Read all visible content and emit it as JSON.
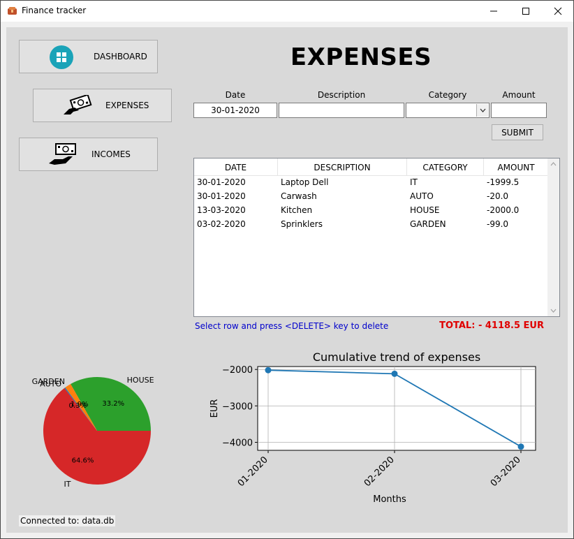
{
  "window": {
    "title": "Finance tracker"
  },
  "nav": {
    "dashboard": "DASHBOARD",
    "expenses": "EXPENSES",
    "incomes": "INCOMES"
  },
  "page": {
    "heading": "EXPENSES"
  },
  "form": {
    "date_label": "Date",
    "description_label": "Description",
    "category_label": "Category",
    "amount_label": "Amount",
    "date_value": "30-01-2020",
    "description_value": "",
    "category_value": "",
    "amount_value": "",
    "submit_label": "SUBMIT"
  },
  "table": {
    "columns": [
      "DATE",
      "DESCRIPTION",
      "CATEGORY",
      "AMOUNT"
    ],
    "rows": [
      [
        "30-01-2020",
        "Laptop Dell",
        "IT",
        "-1999.5"
      ],
      [
        "30-01-2020",
        "Carwash",
        "AUTO",
        "-20.0"
      ],
      [
        "13-03-2020",
        "Kitchen",
        "HOUSE",
        "-2000.0"
      ],
      [
        "03-02-2020",
        "Sprinklers",
        "GARDEN",
        "-99.0"
      ]
    ]
  },
  "hint": "Select row and press <DELETE> key to delete",
  "total": "TOTAL: - 4118.5 EUR",
  "status": "Connected to: data.db",
  "chart_data": [
    {
      "type": "pie",
      "labels": [
        "HOUSE",
        "GARDEN",
        "AUTO",
        "IT"
      ],
      "values": [
        33.2,
        1.9,
        0.3,
        64.6
      ],
      "pct_labels": [
        "33.2%",
        "1.9%",
        "0.3%",
        "64.6%"
      ],
      "colors": [
        "#2ca02c",
        "#ff7f0e",
        "#1f77b4",
        "#d62728"
      ]
    },
    {
      "type": "line",
      "title": "Cumulative trend of expenses",
      "xlabel": "Months",
      "ylabel": "EUR",
      "categories": [
        "01-2020",
        "02-2020",
        "03-2020"
      ],
      "values": [
        -2019.5,
        -2118.5,
        -4118.5
      ],
      "yticks": [
        -2000,
        -3000,
        -4000
      ],
      "ytick_labels": [
        "−2000",
        "−3000",
        "−4000"
      ],
      "ylim": [
        -4220,
        -1920
      ],
      "grid": true,
      "color": "#1f77b4"
    }
  ]
}
